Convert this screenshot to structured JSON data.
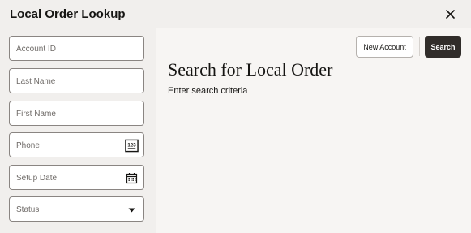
{
  "dialog": {
    "title": "Local Order Lookup",
    "close_icon": "close-icon"
  },
  "form": {
    "account_id": {
      "placeholder": "Account ID"
    },
    "last_name": {
      "placeholder": "Last Name"
    },
    "first_name": {
      "placeholder": "First Name"
    },
    "phone": {
      "placeholder": "Phone",
      "icon": "numeric-keypad-icon",
      "icon_text": "123"
    },
    "setup_date": {
      "placeholder": "Setup Date",
      "icon": "calendar-icon"
    },
    "status": {
      "placeholder": "Status",
      "icon": "chevron-down-icon"
    }
  },
  "actions": {
    "new_account_label": "New Account",
    "search_label": "Search"
  },
  "main": {
    "heading": "Search for Local Order",
    "subtext": "Enter search criteria"
  },
  "colors": {
    "header_bg": "#f1efed",
    "primary_button": "#312d2a",
    "text": "#161513"
  }
}
